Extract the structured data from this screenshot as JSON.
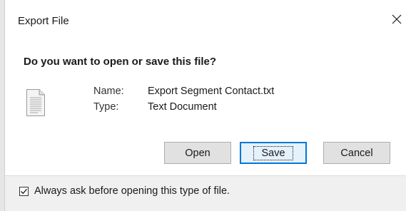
{
  "dialog": {
    "title": "Export File",
    "question": "Do you want to open or save this file?",
    "file": {
      "name_label": "Name:",
      "name_value": "Export Segment Contact.txt",
      "type_label": "Type:",
      "type_value": "Text Document",
      "icon": "text-file-icon"
    },
    "buttons": {
      "open": "Open",
      "save": "Save",
      "cancel": "Cancel"
    },
    "checkbox": {
      "label": "Always ask before opening this type of file.",
      "checked": true
    },
    "colors": {
      "default_button_border": "#0078d7",
      "button_background": "#e1e1e1",
      "footer_background": "#f0f0f0"
    }
  }
}
